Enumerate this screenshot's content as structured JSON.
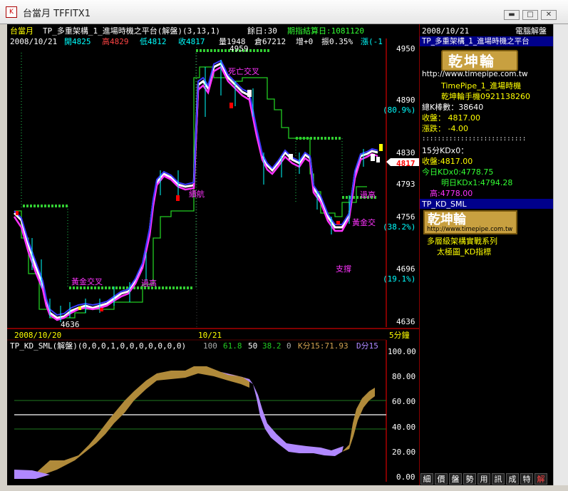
{
  "window": {
    "title": "台當月 TFFITX1",
    "icon_glyph": "K",
    "btn_min": "▬",
    "btn_max": "□",
    "btn_close": "✕"
  },
  "header": {
    "symbol": "台當月",
    "strategy": "TP_多重架構_1_進場時機之平台(解盤)(3,13,1)",
    "remaining": "餘日:30",
    "expiry": "期指結算日:1081120",
    "date": "2008/10/21",
    "open": "開4825",
    "high": "高4829",
    "low": "低4812",
    "close": "收4817",
    "volume": "量1948",
    "oi": "倉67212",
    "oi_change": "增+0",
    "amplitude": "振0.35%",
    "change": "漲(-1"
  },
  "price_axis": {
    "labels": [
      "4950",
      "4890",
      "(80.9%)",
      "4830",
      "4793",
      "4756",
      "(38.2%)",
      "4696",
      "(19.1%)",
      "4636"
    ],
    "current_price": "4817"
  },
  "annotations": {
    "death_cross": "死亡交叉",
    "continue": "續航",
    "golden_cross_left": "黃金交叉",
    "pass_high_left": "過高",
    "pass_high_right": "過高",
    "golden_cross_right": "黃金交",
    "support": "支撐",
    "peak_value": "4959",
    "low_value": "4636"
  },
  "time_axis": {
    "date_left": "2008/10/20",
    "date_mid": "10/21",
    "period": "5分鐘"
  },
  "indicator": {
    "name": "TP_KD_SML(解盤)(0,0,0,1,0,0,0,0,0,0,0)",
    "v100": "100",
    "v618": "61.8",
    "v50": "50",
    "v382": "38.2",
    "v0": "0",
    "k15": "K分15:71.93",
    "d15": "D分15",
    "axis": [
      "100.00",
      "80.00",
      "60.00",
      "40.00",
      "20.00",
      "0.00"
    ]
  },
  "sidebar": {
    "date": "2008/10/21",
    "title": "電腦解盤",
    "strategy": "TP_多重架構_1_進場時機之平台",
    "logo_text": "乾坤輪",
    "url": "http://www.timepipe.com.tw",
    "brand": "TimePipe_1_進場時機",
    "phone": "乾坤輪手機0921138260",
    "bar_count": "總K棒數：38640",
    "close": "收盤： 4817.00",
    "change": "漲跌： -4.00",
    "dots": ":::::::::::::::::::::::::::",
    "kd_title": "15分KDx0：",
    "kd_close": "收盤:4817.00",
    "kd_today": "今日KDx0:4778.75",
    "kd_tomorrow": "明日KDx1:4794.28",
    "kd_high": "高:4778.00",
    "panel2_title": "TP_KD_SML",
    "panel2_logo": "乾坤輪",
    "panel2_url": "http://www.timepipe.com.tw",
    "series_line1": "多層級架構實戰系列",
    "series_line2": "太極圖_KD指標",
    "buttons": [
      "細",
      "價",
      "盤",
      "勢",
      "用",
      "訊",
      "成",
      "特",
      "解"
    ]
  },
  "colors": {
    "background": "#000000",
    "yellow": "#ffff00",
    "green_dot": "#32cd32",
    "magenta": "#ff33ff",
    "red_axis": "#ff0000",
    "white": "#ffffff",
    "cyan": "#00ffff",
    "blue": "#4040ff",
    "gold": "#b08a3a",
    "lavender": "#b088ff"
  }
}
